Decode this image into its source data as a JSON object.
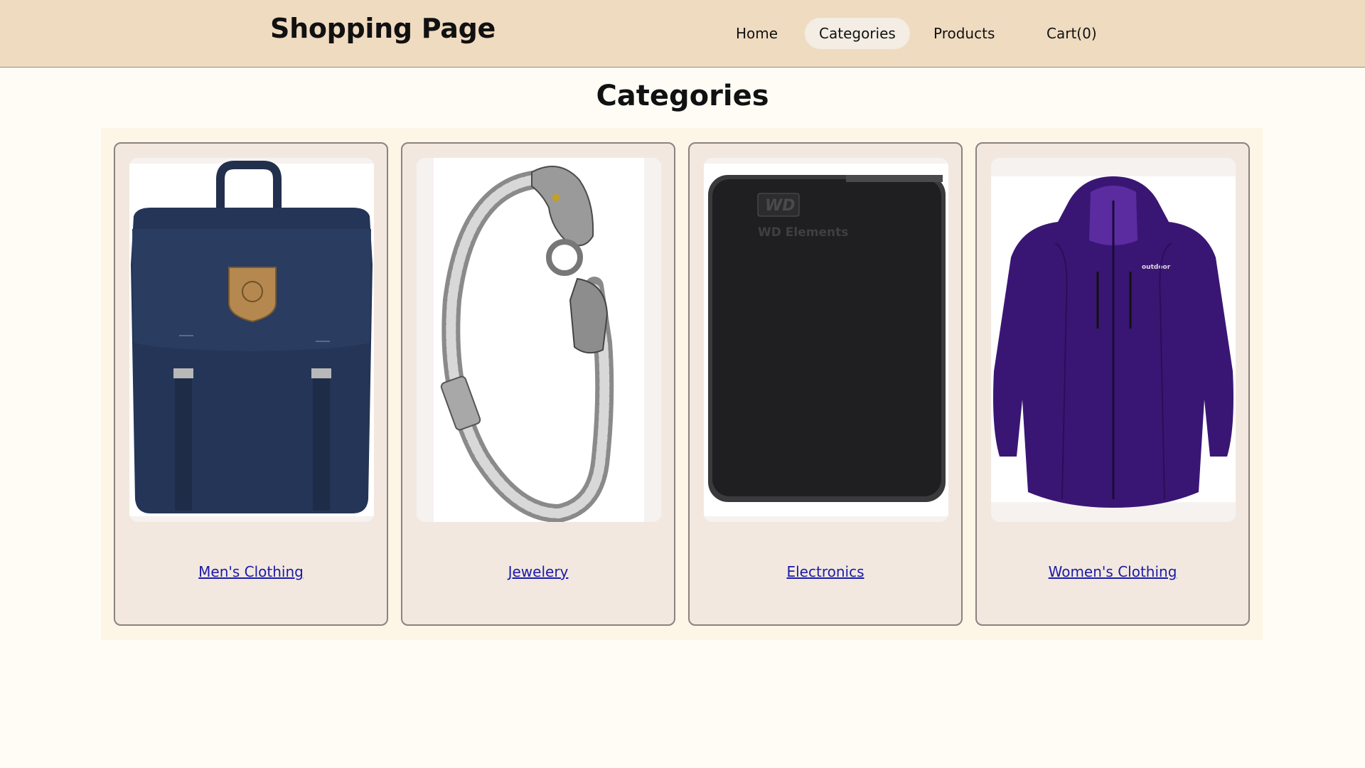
{
  "header": {
    "brand": "Shopping Page",
    "nav": [
      {
        "label": "Home",
        "active": false
      },
      {
        "label": "Categories",
        "active": true
      },
      {
        "label": "Products",
        "active": false
      },
      {
        "label": "Cart(0)",
        "active": false
      }
    ]
  },
  "main": {
    "title": "Categories",
    "categories": [
      {
        "label": "Men's Clothing",
        "image": "navy-backpack"
      },
      {
        "label": "Jewelery",
        "image": "dragon-chain-bracelet"
      },
      {
        "label": "Electronics",
        "image": "external-hard-drive",
        "image_text": "WD Elements"
      },
      {
        "label": "Women's Clothing",
        "image": "purple-jacket",
        "image_text": "outdoor"
      }
    ]
  },
  "colors": {
    "header_bg": "#efdbc0",
    "page_bg": "#fefcf5",
    "card_bg": "#f3e8df",
    "link": "#1a1aa8",
    "active_nav_bg": "#f3ede4"
  }
}
